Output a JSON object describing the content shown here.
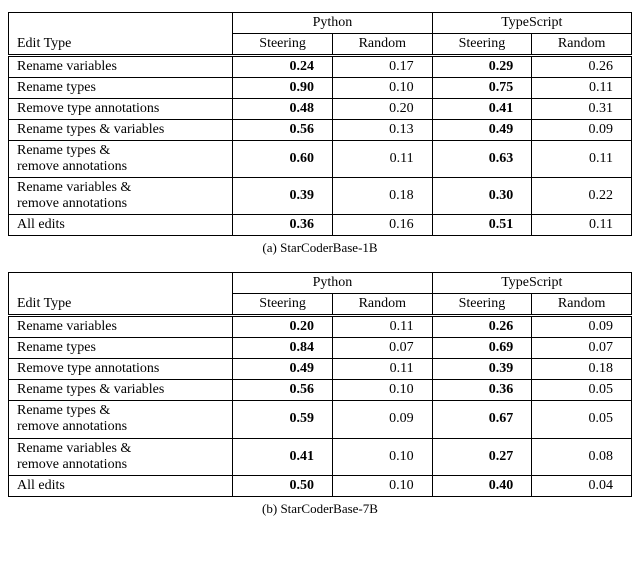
{
  "header": {
    "col_edit": "Edit Type",
    "lang1": "Python",
    "lang2": "TypeScript",
    "sub_steer": "Steering",
    "sub_rand": "Random"
  },
  "rows_labels": {
    "r0": "Rename variables",
    "r1": "Rename types",
    "r2": "Remove type annotations",
    "r3": "Rename types & variables",
    "r4a": "Rename types &",
    "r4b": "remove annotations",
    "r5a": "Rename variables &",
    "r5b": "remove annotations",
    "r6": "All edits"
  },
  "table_a": {
    "caption": "(a) StarCoderBase-1B",
    "r0": {
      "ps": "0.24",
      "pr": "0.17",
      "ts": "0.29",
      "tr": "0.26"
    },
    "r1": {
      "ps": "0.90",
      "pr": "0.10",
      "ts": "0.75",
      "tr": "0.11"
    },
    "r2": {
      "ps": "0.48",
      "pr": "0.20",
      "ts": "0.41",
      "tr": "0.31"
    },
    "r3": {
      "ps": "0.56",
      "pr": "0.13",
      "ts": "0.49",
      "tr": "0.09"
    },
    "r4": {
      "ps": "0.60",
      "pr": "0.11",
      "ts": "0.63",
      "tr": "0.11"
    },
    "r5": {
      "ps": "0.39",
      "pr": "0.18",
      "ts": "0.30",
      "tr": "0.22"
    },
    "r6": {
      "ps": "0.36",
      "pr": "0.16",
      "ts": "0.51",
      "tr": "0.11"
    }
  },
  "table_b": {
    "caption": "(b) StarCoderBase-7B",
    "r0": {
      "ps": "0.20",
      "pr": "0.11",
      "ts": "0.26",
      "tr": "0.09"
    },
    "r1": {
      "ps": "0.84",
      "pr": "0.07",
      "ts": "0.69",
      "tr": "0.07"
    },
    "r2": {
      "ps": "0.49",
      "pr": "0.11",
      "ts": "0.39",
      "tr": "0.18"
    },
    "r3": {
      "ps": "0.56",
      "pr": "0.10",
      "ts": "0.36",
      "tr": "0.05"
    },
    "r4": {
      "ps": "0.59",
      "pr": "0.09",
      "ts": "0.67",
      "tr": "0.05"
    },
    "r5": {
      "ps": "0.41",
      "pr": "0.10",
      "ts": "0.27",
      "tr": "0.08"
    },
    "r6": {
      "ps": "0.50",
      "pr": "0.10",
      "ts": "0.40",
      "tr": "0.04"
    }
  },
  "chart_data": [
    {
      "type": "table",
      "title": "StarCoderBase-1B",
      "columns": [
        "Edit Type",
        "Python Steering",
        "Python Random",
        "TypeScript Steering",
        "TypeScript Random"
      ],
      "rows": [
        [
          "Rename variables",
          0.24,
          0.17,
          0.29,
          0.26
        ],
        [
          "Rename types",
          0.9,
          0.1,
          0.75,
          0.11
        ],
        [
          "Remove type annotations",
          0.48,
          0.2,
          0.41,
          0.31
        ],
        [
          "Rename types & variables",
          0.56,
          0.13,
          0.49,
          0.09
        ],
        [
          "Rename types & remove annotations",
          0.6,
          0.11,
          0.63,
          0.11
        ],
        [
          "Rename variables & remove annotations",
          0.39,
          0.18,
          0.3,
          0.22
        ],
        [
          "All edits",
          0.36,
          0.16,
          0.51,
          0.11
        ]
      ]
    },
    {
      "type": "table",
      "title": "StarCoderBase-7B",
      "columns": [
        "Edit Type",
        "Python Steering",
        "Python Random",
        "TypeScript Steering",
        "TypeScript Random"
      ],
      "rows": [
        [
          "Rename variables",
          0.2,
          0.11,
          0.26,
          0.09
        ],
        [
          "Rename types",
          0.84,
          0.07,
          0.69,
          0.07
        ],
        [
          "Remove type annotations",
          0.49,
          0.11,
          0.39,
          0.18
        ],
        [
          "Rename types & variables",
          0.56,
          0.1,
          0.36,
          0.05
        ],
        [
          "Rename types & remove annotations",
          0.59,
          0.09,
          0.67,
          0.05
        ],
        [
          "Rename variables & remove annotations",
          0.41,
          0.1,
          0.27,
          0.08
        ],
        [
          "All edits",
          0.5,
          0.1,
          0.4,
          0.04
        ]
      ]
    }
  ]
}
